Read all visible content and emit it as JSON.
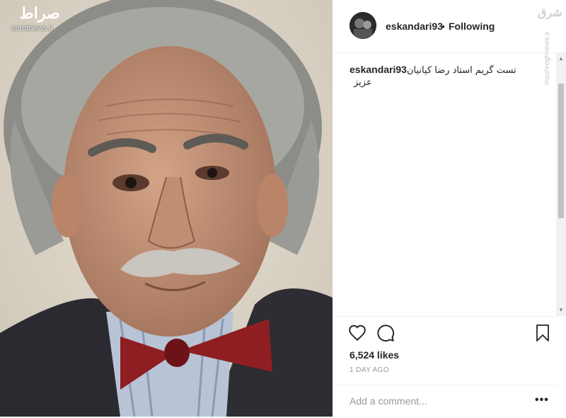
{
  "photo": {
    "description_icon": "portrait-photo"
  },
  "watermark_left": {
    "logo": "صراط",
    "site": "seratnews.ir"
  },
  "watermark_right": {
    "logo": "شرق",
    "site": "mashreghnews.ir"
  },
  "post": {
    "username": "eskandari93",
    "separator": "•",
    "follow_status": "Following",
    "caption_user": "eskandari93",
    "caption_text": "تست گریم استاد رضا کیانیان عزیز",
    "likes": "6,524 likes",
    "time": "1 DAY AGO",
    "comment_placeholder": "Add a comment...",
    "more_label": "•••"
  },
  "icons": {
    "like": "heart-icon",
    "comment": "comment-icon",
    "save": "bookmark-icon"
  }
}
